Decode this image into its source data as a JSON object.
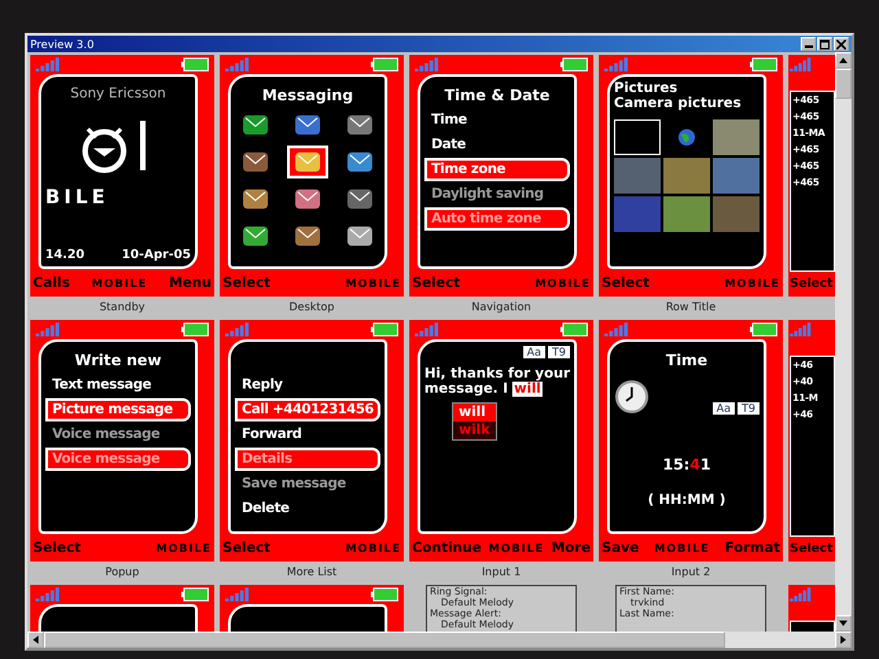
{
  "window": {
    "title": "Preview 3.0"
  },
  "rows": [
    {
      "cells": [
        {
          "kind": "standby",
          "caption": "Standby",
          "operator": "Sony Ericsson",
          "wallpaper_text": "BILE",
          "time": "14.20",
          "date": "10-Apr-05",
          "softkeys": {
            "left": "Calls",
            "center": "MOBILE",
            "right": "Menu"
          }
        },
        {
          "kind": "desktop",
          "caption": "Desktop",
          "title": "Messaging",
          "icons": [
            {
              "selected": false
            },
            {
              "selected": false
            },
            {
              "selected": false
            },
            {
              "selected": false
            },
            {
              "selected": true
            },
            {
              "selected": false
            },
            {
              "selected": false
            },
            {
              "selected": false
            },
            {
              "selected": false
            },
            {
              "selected": false
            },
            {
              "selected": false
            },
            {
              "selected": false
            }
          ],
          "softkeys": {
            "left": "Select",
            "center": "MOBILE"
          }
        },
        {
          "kind": "list",
          "caption": "Navigation",
          "title": "Time & Date",
          "items": [
            {
              "label": "Time",
              "selected": false,
              "disabled": false
            },
            {
              "label": "Date",
              "selected": false,
              "disabled": false
            },
            {
              "label": "Time zone",
              "selected": true,
              "disabled": false
            },
            {
              "label": "Daylight saving",
              "selected": false,
              "disabled": true
            },
            {
              "label": "Auto time zone",
              "selected": true,
              "disabled": true
            }
          ],
          "softkeys": {
            "left": "Select",
            "center": "MOBILE"
          }
        },
        {
          "kind": "gallery",
          "caption": "Row Title",
          "title": "Pictures",
          "subtitle": "Camera pictures",
          "thumbnails": [
            {
              "selected": true
            },
            {
              "selected": false
            },
            {
              "selected": false
            },
            {
              "selected": false
            },
            {
              "selected": false
            },
            {
              "selected": false
            },
            {
              "selected": false
            },
            {
              "selected": false
            },
            {
              "selected": false
            }
          ],
          "softkeys": {
            "left": "Select",
            "center": "MOBILE"
          }
        }
      ],
      "edge": {
        "lines": [
          "+465",
          "+465",
          "11-MA",
          "+465",
          "+465",
          "+465"
        ],
        "softkey": "Select"
      }
    },
    {
      "cells": [
        {
          "kind": "list",
          "caption": "Popup",
          "title": "Write new",
          "items": [
            {
              "label": "Text message",
              "selected": false,
              "disabled": false
            },
            {
              "label": "Picture message",
              "selected": true,
              "disabled": false
            },
            {
              "label": "Voice message",
              "selected": false,
              "disabled": true
            },
            {
              "label": "Voice message",
              "selected": true,
              "disabled": true
            }
          ],
          "softkeys": {
            "left": "Select",
            "center": "MOBILE"
          }
        },
        {
          "kind": "list",
          "caption": "More List",
          "items": [
            {
              "label": "Reply",
              "selected": false,
              "disabled": false
            },
            {
              "label": "Call +4401231456",
              "selected": true,
              "disabled": false
            },
            {
              "label": "Forward",
              "selected": false,
              "disabled": false
            },
            {
              "label": "Details",
              "selected": true,
              "disabled": true
            },
            {
              "label": "Save message",
              "selected": false,
              "disabled": true
            },
            {
              "label": "Delete",
              "selected": false,
              "disabled": false
            }
          ],
          "softkeys": {
            "left": "Select",
            "center": "MOBILE"
          }
        },
        {
          "kind": "input",
          "caption": "Input 1",
          "modes": [
            "Aa",
            "T9"
          ],
          "text": "Hi, thanks for your message. I",
          "typed": "will",
          "suggestions": [
            {
              "label": "will",
              "selected": true
            },
            {
              "label": "wilk",
              "selected": false
            }
          ],
          "softkeys": {
            "left": "Continue",
            "center": "MOBILE",
            "right": "More"
          }
        },
        {
          "kind": "time",
          "caption": "Input 2",
          "title": "Time",
          "modes": [
            "Aa",
            "T9"
          ],
          "hours": "15",
          "separator": ":",
          "minute_tens": "4",
          "minute_ones": "1",
          "format": "( HH:MM )",
          "softkeys": {
            "left": "Save",
            "center": "MOBILE",
            "right": "Format"
          }
        }
      ],
      "edge": {
        "lines": [
          "+46",
          "+40",
          "11-M",
          "+46"
        ],
        "softkey": "Select"
      }
    },
    {
      "cells": [
        {
          "kind": "stub"
        },
        {
          "kind": "stub"
        },
        {
          "kind": "info",
          "lines": [
            {
              "text": "Ring Signal:",
              "indented": false
            },
            {
              "text": "Default Melody",
              "indented": true
            },
            {
              "text": "Message Alert:",
              "indented": false
            },
            {
              "text": "Default Melody",
              "indented": true
            }
          ]
        },
        {
          "kind": "info",
          "lines": [
            {
              "text": "First Name:",
              "indented": false
            },
            {
              "text": "trvkind",
              "indented": true
            },
            {
              "text": "Last Name:",
              "indented": false
            }
          ]
        }
      ],
      "edge": {}
    }
  ]
}
